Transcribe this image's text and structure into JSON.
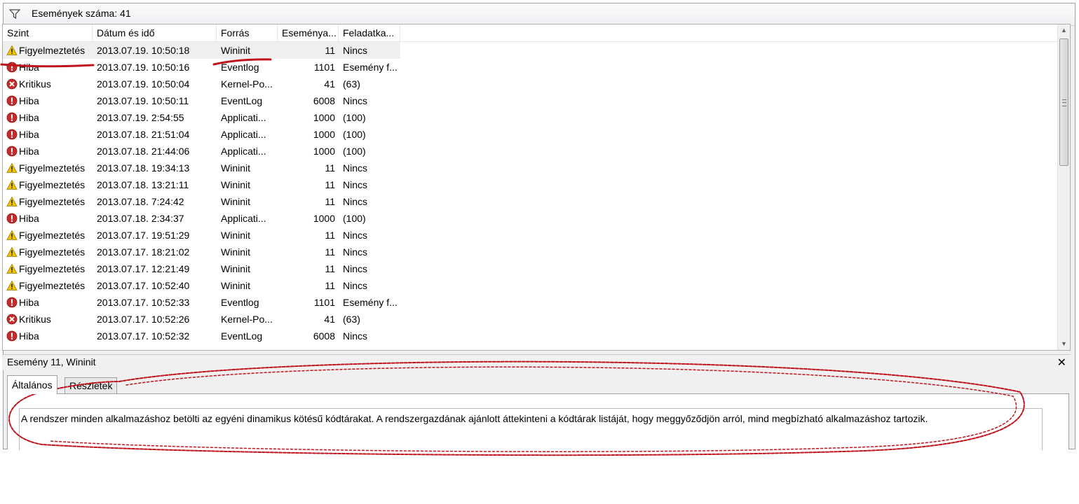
{
  "filter": {
    "count_label": "Események száma: 41",
    "icon": "funnel-icon"
  },
  "columns": [
    "Szint",
    "Dátum és idő",
    "Forrás",
    "Eseménya...",
    "Feladatka..."
  ],
  "rows": [
    {
      "level": "Figyelmeztetés",
      "type": "warning",
      "date": "2013.07.19. 10:50:18",
      "source": "Wininit",
      "id": "11",
      "task": "Nincs"
    },
    {
      "level": "Hiba",
      "type": "error",
      "date": "2013.07.19. 10:50:16",
      "source": "Eventlog",
      "id": "1101",
      "task": "Esemény f..."
    },
    {
      "level": "Kritikus",
      "type": "critical",
      "date": "2013.07.19. 10:50:04",
      "source": "Kernel-Po...",
      "id": "41",
      "task": "(63)"
    },
    {
      "level": "Hiba",
      "type": "error",
      "date": "2013.07.19. 10:50:11",
      "source": "EventLog",
      "id": "6008",
      "task": "Nincs"
    },
    {
      "level": "Hiba",
      "type": "error",
      "date": "2013.07.19. 2:54:55",
      "source": "Applicati...",
      "id": "1000",
      "task": "(100)"
    },
    {
      "level": "Hiba",
      "type": "error",
      "date": "2013.07.18. 21:51:04",
      "source": "Applicati...",
      "id": "1000",
      "task": "(100)"
    },
    {
      "level": "Hiba",
      "type": "error",
      "date": "2013.07.18. 21:44:06",
      "source": "Applicati...",
      "id": "1000",
      "task": "(100)"
    },
    {
      "level": "Figyelmeztetés",
      "type": "warning",
      "date": "2013.07.18. 19:34:13",
      "source": "Wininit",
      "id": "11",
      "task": "Nincs"
    },
    {
      "level": "Figyelmeztetés",
      "type": "warning",
      "date": "2013.07.18. 13:21:11",
      "source": "Wininit",
      "id": "11",
      "task": "Nincs"
    },
    {
      "level": "Figyelmeztetés",
      "type": "warning",
      "date": "2013.07.18. 7:24:42",
      "source": "Wininit",
      "id": "11",
      "task": "Nincs"
    },
    {
      "level": "Hiba",
      "type": "error",
      "date": "2013.07.18. 2:34:37",
      "source": "Applicati...",
      "id": "1000",
      "task": "(100)"
    },
    {
      "level": "Figyelmeztetés",
      "type": "warning",
      "date": "2013.07.17. 19:51:29",
      "source": "Wininit",
      "id": "11",
      "task": "Nincs"
    },
    {
      "level": "Figyelmeztetés",
      "type": "warning",
      "date": "2013.07.17. 18:21:02",
      "source": "Wininit",
      "id": "11",
      "task": "Nincs"
    },
    {
      "level": "Figyelmeztetés",
      "type": "warning",
      "date": "2013.07.17. 12:21:49",
      "source": "Wininit",
      "id": "11",
      "task": "Nincs"
    },
    {
      "level": "Figyelmeztetés",
      "type": "warning",
      "date": "2013.07.17. 10:52:40",
      "source": "Wininit",
      "id": "11",
      "task": "Nincs"
    },
    {
      "level": "Hiba",
      "type": "error",
      "date": "2013.07.17. 10:52:33",
      "source": "Eventlog",
      "id": "1101",
      "task": "Esemény f..."
    },
    {
      "level": "Kritikus",
      "type": "critical",
      "date": "2013.07.17. 10:52:26",
      "source": "Kernel-Po...",
      "id": "41",
      "task": "(63)"
    },
    {
      "level": "Hiba",
      "type": "error",
      "date": "2013.07.17. 10:52:32",
      "source": "EventLog",
      "id": "6008",
      "task": "Nincs"
    }
  ],
  "detail": {
    "title": "Esemény 11, Wininit",
    "tabs": [
      {
        "label": "Általános",
        "active": true
      },
      {
        "label": "Részletek",
        "active": false
      }
    ],
    "description": "A rendszer minden alkalmazáshoz betölti az egyéni dinamikus kötésű kódtárakat. A rendszergazdának ajánlott áttekinteni a kódtárak listáját, hogy meggyőződjön arról, mind megbízható alkalmazáshoz tartozik."
  },
  "colors": {
    "annotation": "#c0141c",
    "error": "#c42b2b",
    "warning": "#f2c200",
    "selection": "#efefef"
  }
}
